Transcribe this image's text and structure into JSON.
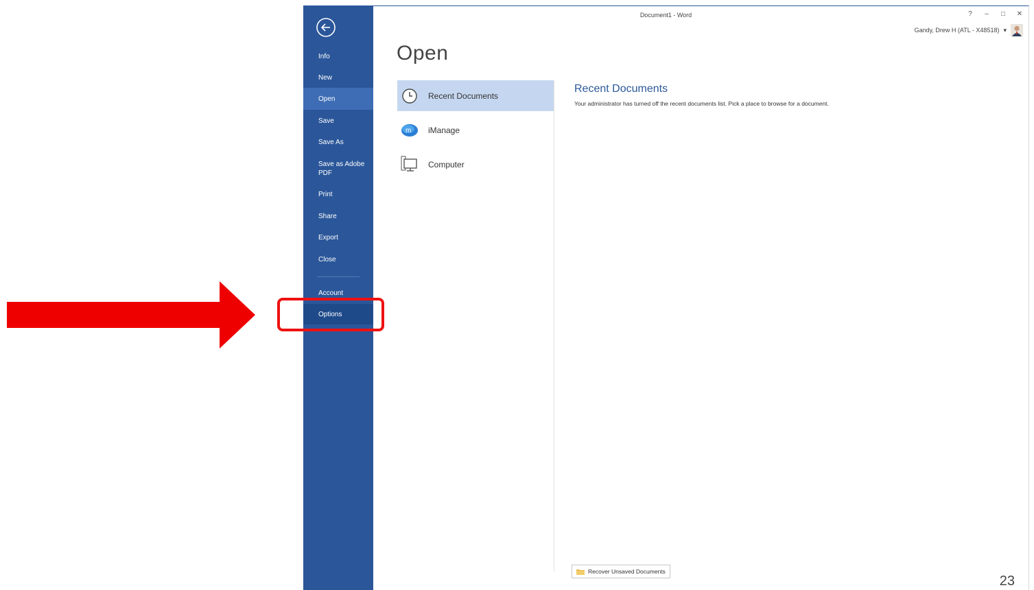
{
  "window": {
    "title": "Document1 - Word",
    "controls": {
      "help": "?",
      "minimize": "–",
      "restore": "□",
      "close": "✕"
    },
    "user_name": "Gandy, Drew H (ATL - X48518)",
    "user_dropdown": "▾"
  },
  "nav": {
    "items": [
      {
        "label": "Info"
      },
      {
        "label": "New"
      },
      {
        "label": "Open"
      },
      {
        "label": "Save"
      },
      {
        "label": "Save As"
      },
      {
        "label": "Save as Adobe PDF"
      },
      {
        "label": "Print"
      },
      {
        "label": "Share"
      },
      {
        "label": "Export"
      },
      {
        "label": "Close"
      },
      {
        "label": "Account"
      },
      {
        "label": "Options"
      }
    ],
    "selected": "Open"
  },
  "main": {
    "heading": "Open",
    "places": [
      {
        "label": "Recent Documents",
        "icon": "clock-icon"
      },
      {
        "label": "iManage",
        "icon": "imanage-icon"
      },
      {
        "label": "Computer",
        "icon": "computer-icon"
      }
    ],
    "recent": {
      "title": "Recent Documents",
      "message": "Your administrator has turned off the recent documents list. Pick a place to browse for a document."
    },
    "recover_label": "Recover Unsaved Documents"
  },
  "annotation": {
    "arrow_color": "#ee0000",
    "highlight_color": "#ee1111"
  },
  "slide_number": "23",
  "colors": {
    "nav_bg": "#2b579a",
    "nav_selected": "#3e6db5",
    "place_selected": "#c5d7f0",
    "accent_text": "#2b579a"
  }
}
